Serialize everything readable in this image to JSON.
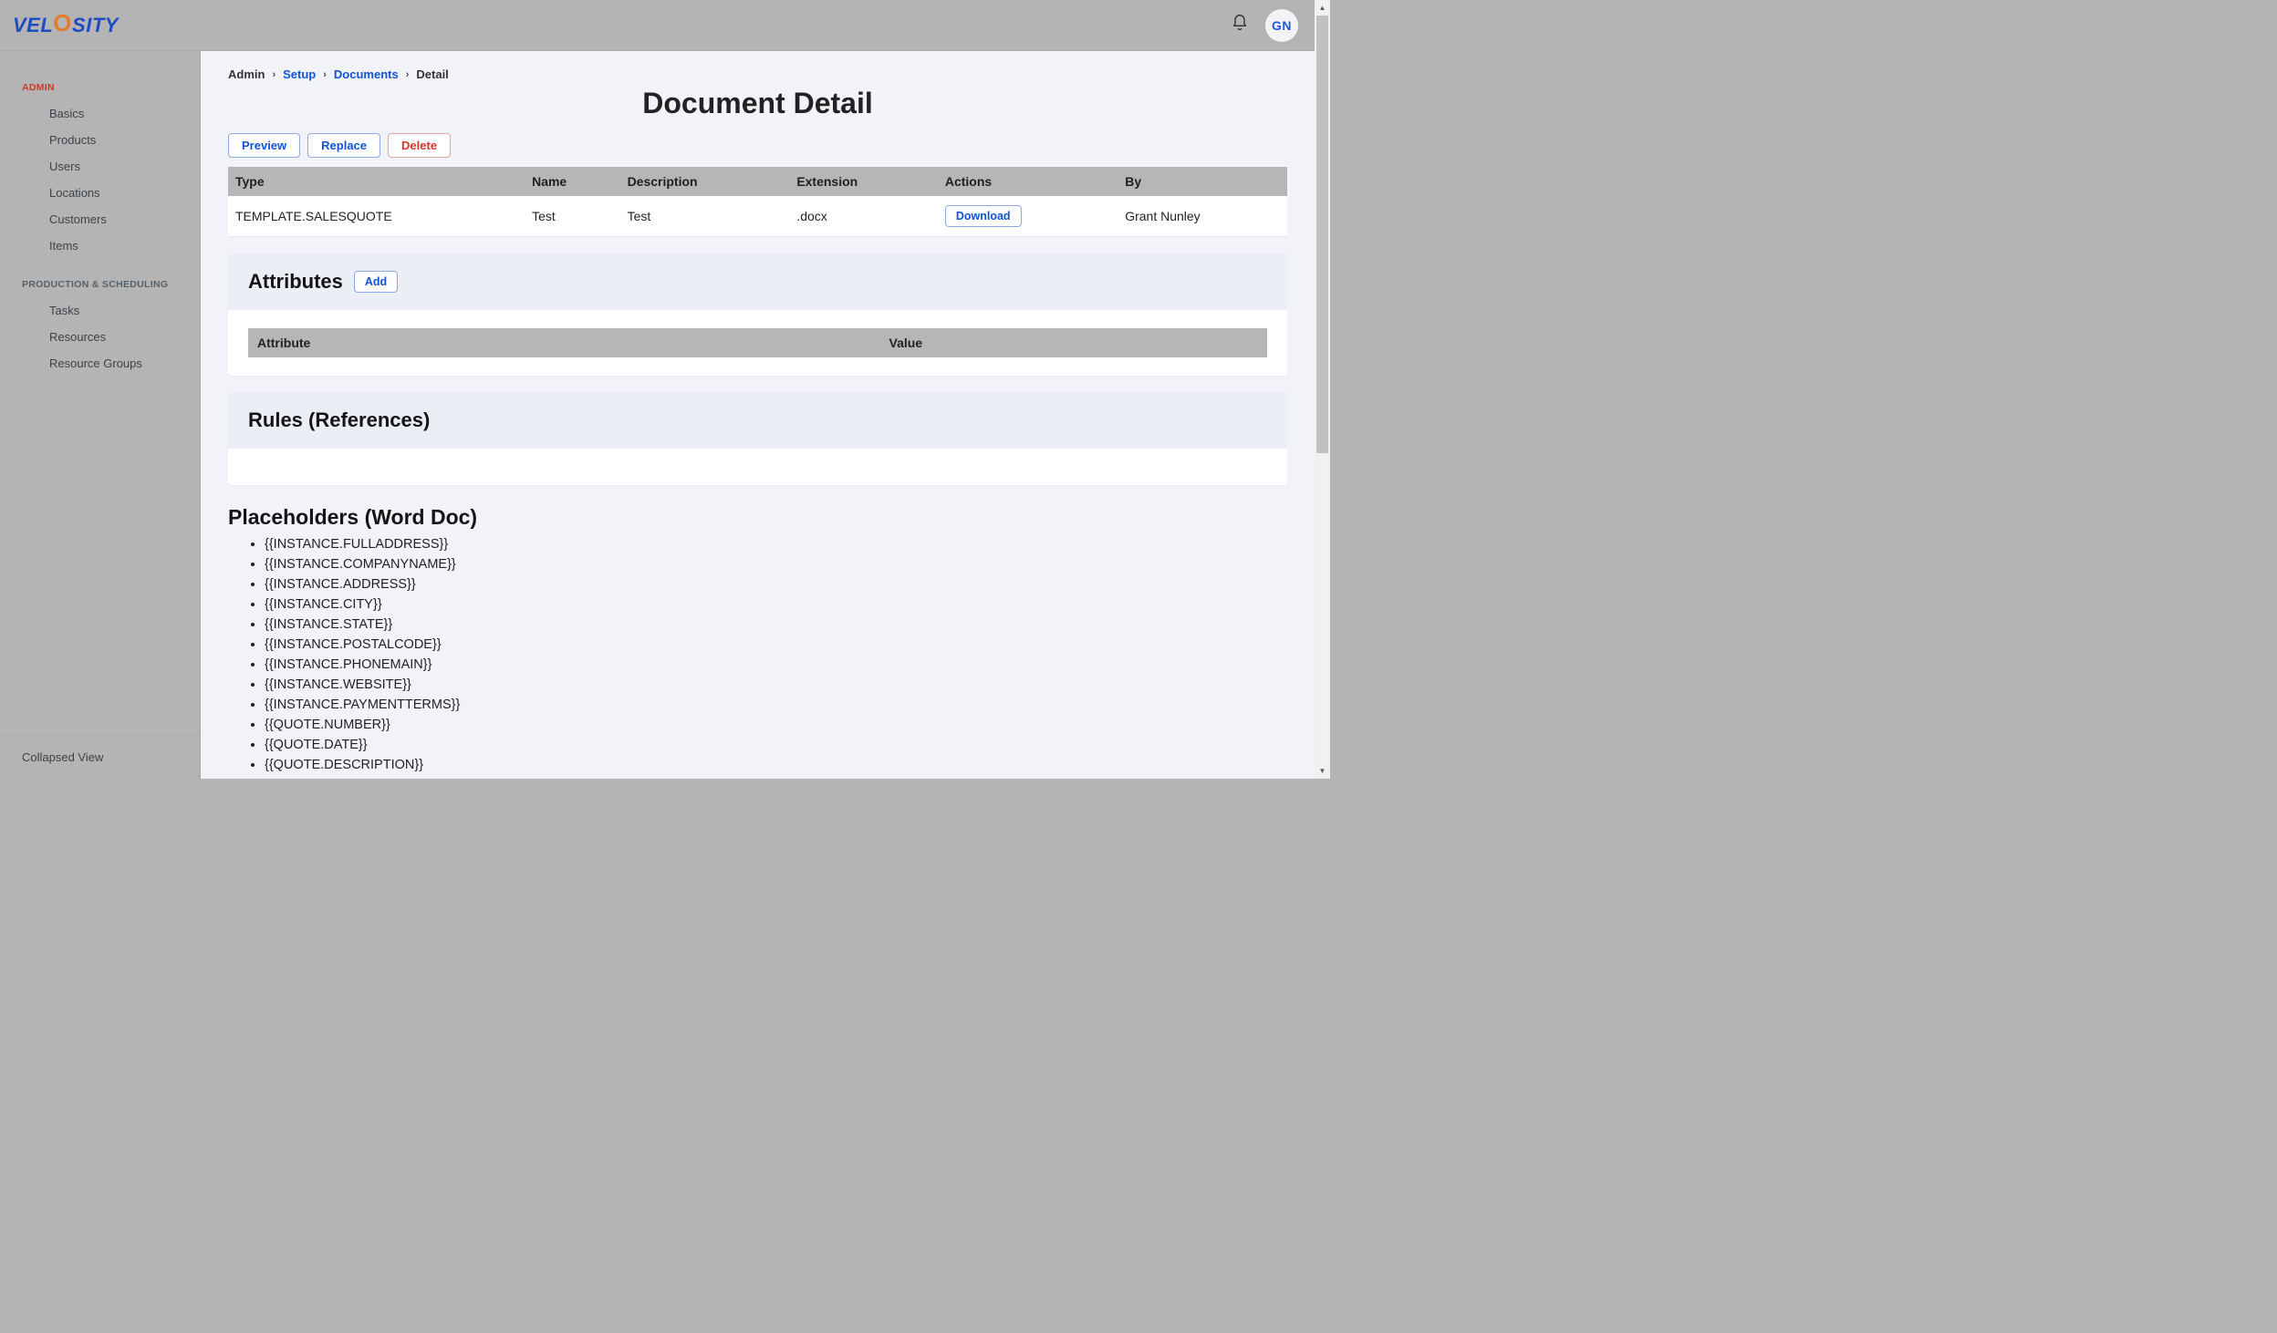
{
  "header": {
    "logo_parts": {
      "pre": "VEL",
      "swirl": "O",
      "post": "SITY"
    },
    "avatar_initials": "GN"
  },
  "sidebar": {
    "collapsed_label": "Collapsed View",
    "sections": [
      {
        "label": "ADMIN",
        "class": "admin",
        "items": [
          "Basics",
          "Products",
          "Users",
          "Locations",
          "Customers",
          "Items"
        ]
      },
      {
        "label": "PRODUCTION & SCHEDULING",
        "class": "",
        "items": [
          "Tasks",
          "Resources",
          "Resource Groups"
        ]
      }
    ]
  },
  "breadcrumbs": [
    {
      "text": "Admin",
      "link": false
    },
    {
      "text": "Setup",
      "link": true
    },
    {
      "text": "Documents",
      "link": true
    },
    {
      "text": "Detail",
      "link": false
    }
  ],
  "page_title": "Document Detail",
  "actions": {
    "preview": "Preview",
    "replace": "Replace",
    "delete": "Delete"
  },
  "doc_table": {
    "headers": [
      "Type",
      "Name",
      "Description",
      "Extension",
      "Actions",
      "By"
    ],
    "row": {
      "type": "TEMPLATE.SALESQUOTE",
      "name": "Test",
      "description": "Test",
      "extension": ".docx",
      "action_label": "Download",
      "by": "Grant Nunley"
    }
  },
  "attributes": {
    "title": "Attributes",
    "add_label": "Add",
    "headers": [
      "Attribute",
      "Value"
    ]
  },
  "rules": {
    "title": "Rules (References)"
  },
  "placeholders": {
    "title": "Placeholders (Word Doc)",
    "items": [
      "{{INSTANCE.FULLADDRESS}}",
      "{{INSTANCE.COMPANYNAME}}",
      "{{INSTANCE.ADDRESS}}",
      "{{INSTANCE.CITY}}",
      "{{INSTANCE.STATE}}",
      "{{INSTANCE.POSTALCODE}}",
      "{{INSTANCE.PHONEMAIN}}",
      "{{INSTANCE.WEBSITE}}",
      "{{INSTANCE.PAYMENTTERMS}}",
      "{{QUOTE.NUMBER}}",
      "{{QUOTE.DATE}}",
      "{{QUOTE.DESCRIPTION}}"
    ]
  }
}
